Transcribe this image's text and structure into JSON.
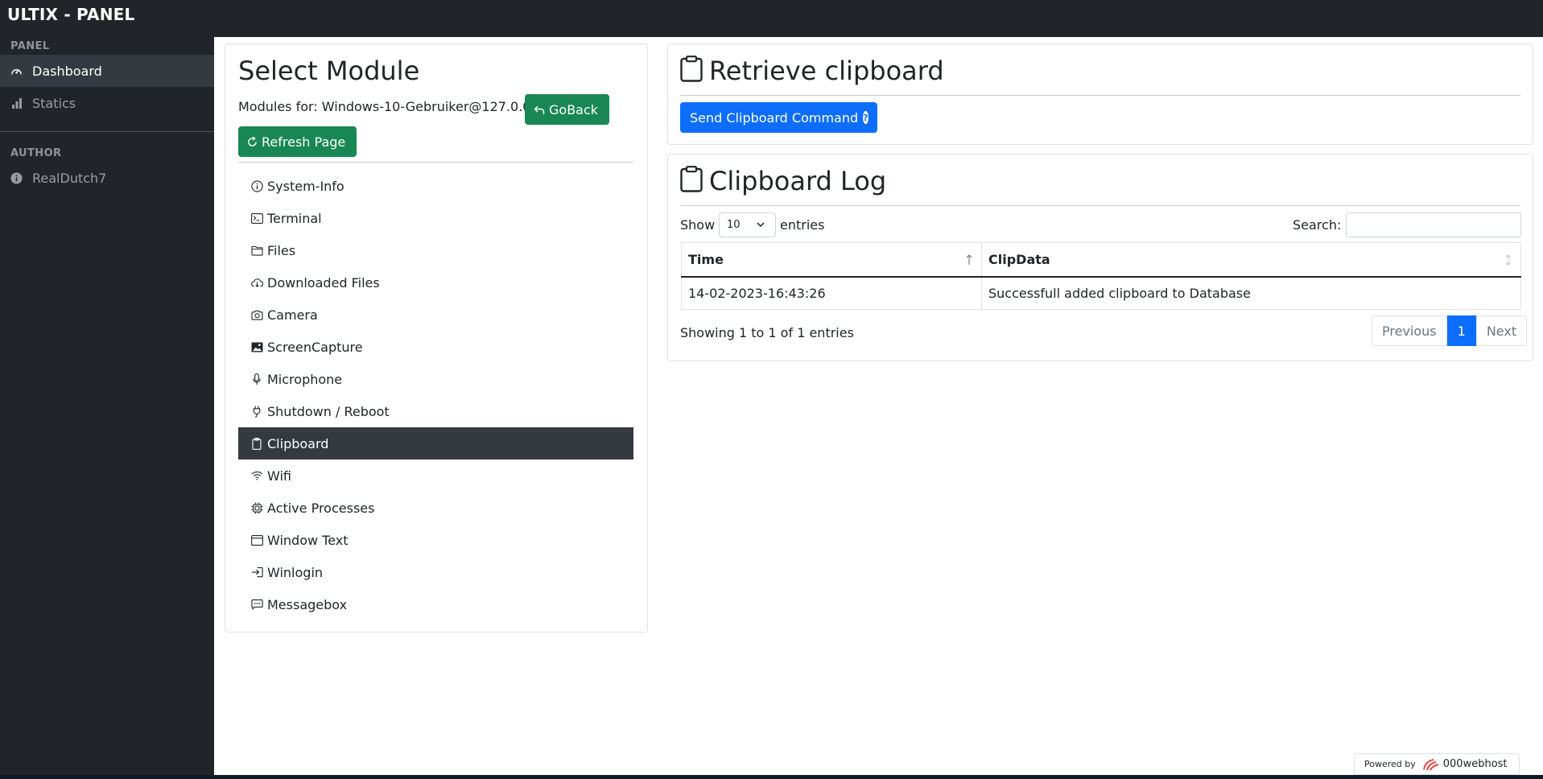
{
  "app": {
    "brand": "ULTIX - PANEL"
  },
  "sidebar": {
    "sections": [
      {
        "heading": "PANEL"
      },
      {
        "heading": "AUTHOR"
      }
    ],
    "items": [
      {
        "label": "Dashboard",
        "icon": "speedometer-icon",
        "active": true
      },
      {
        "label": "Statics",
        "icon": "bar-chart-icon",
        "active": false
      },
      {
        "label": "RealDutch7",
        "icon": "info-icon",
        "active": false
      }
    ]
  },
  "module_card": {
    "title": "Select Module",
    "modules_for": "Modules for: Windows-10-Gebruiker@127.0.0.1",
    "goback_label": "GoBack",
    "refresh_label": "Refresh Page",
    "modules": [
      {
        "label": "System-Info",
        "icon": "info-icon",
        "active": false
      },
      {
        "label": "Terminal",
        "icon": "terminal-icon",
        "active": false
      },
      {
        "label": "Files",
        "icon": "folder-icon",
        "active": false
      },
      {
        "label": "Downloaded Files",
        "icon": "cloud-download-icon",
        "active": false
      },
      {
        "label": "Camera",
        "icon": "camera-icon",
        "active": false
      },
      {
        "label": "ScreenCapture",
        "icon": "image-icon",
        "active": false
      },
      {
        "label": "Microphone",
        "icon": "microphone-icon",
        "active": false
      },
      {
        "label": "Shutdown / Reboot",
        "icon": "plug-icon",
        "active": false
      },
      {
        "label": "Clipboard",
        "icon": "clipboard-icon",
        "active": true
      },
      {
        "label": "Wifi",
        "icon": "wifi-icon",
        "active": false
      },
      {
        "label": "Active Processes",
        "icon": "cpu-icon",
        "active": false
      },
      {
        "label": "Window Text",
        "icon": "window-icon",
        "active": false
      },
      {
        "label": "Winlogin",
        "icon": "login-icon",
        "active": false
      },
      {
        "label": "Messagebox",
        "icon": "chat-icon",
        "active": false
      }
    ]
  },
  "retrieve_card": {
    "title": "Retrieve clipboard",
    "send_button": "Send Clipboard Command",
    "help_glyph": "?"
  },
  "log_card": {
    "title": "Clipboard Log",
    "show_label": "Show",
    "entries_value": "10",
    "entries_label": "entries",
    "search_label": "Search:",
    "search_value": "",
    "columns": [
      "Time",
      "ClipData"
    ],
    "rows": [
      [
        "14-02-2023-16:43:26",
        "Successfull added clipboard to Database"
      ]
    ],
    "info": "Showing 1 to 1 of 1 entries",
    "pager": {
      "previous": "Previous",
      "current": "1",
      "next": "Next"
    }
  },
  "footer": {
    "powered_by": "Powered by",
    "host_name": "000webhost"
  },
  "colors": {
    "dark": "#212529",
    "active_bg": "#343a40",
    "primary": "#0d6efd",
    "success": "#198754"
  }
}
